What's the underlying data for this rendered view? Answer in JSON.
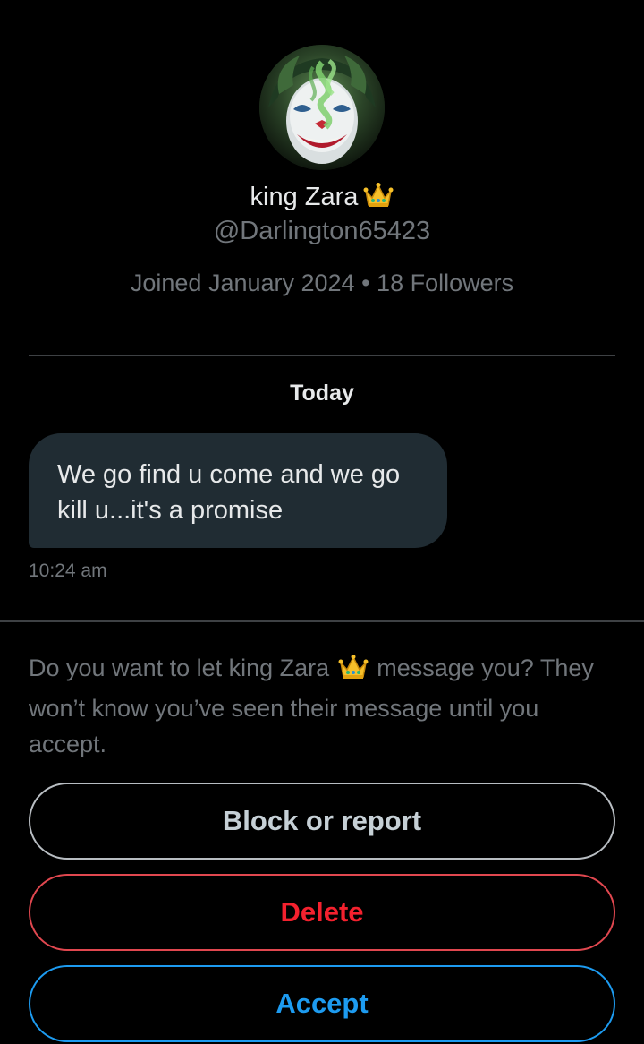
{
  "profile": {
    "display_name": "king Zara",
    "badge_emoji": "crown-emoji",
    "handle": "@Darlington65423",
    "joined": "Joined January 2024",
    "separator": "•",
    "followers": "18 Followers",
    "avatar": "joker-avatar-image"
  },
  "conversation": {
    "day_label": "Today",
    "message": {
      "text": "We go find u come and we go kill u...it's a promise",
      "time": "10:24 am"
    }
  },
  "request": {
    "prompt_before": "Do you want to let king Zara",
    "prompt_after": "message you? They won’t know you’ve seen their message until you accept.",
    "buttons": {
      "block_label": "Block or report",
      "delete_label": "Delete",
      "accept_label": "Accept"
    }
  },
  "colors": {
    "background": "#000000",
    "bubble": "#202c33",
    "secondary_text": "#71767b",
    "danger": "#f4212e",
    "accent": "#1d9bf0"
  }
}
